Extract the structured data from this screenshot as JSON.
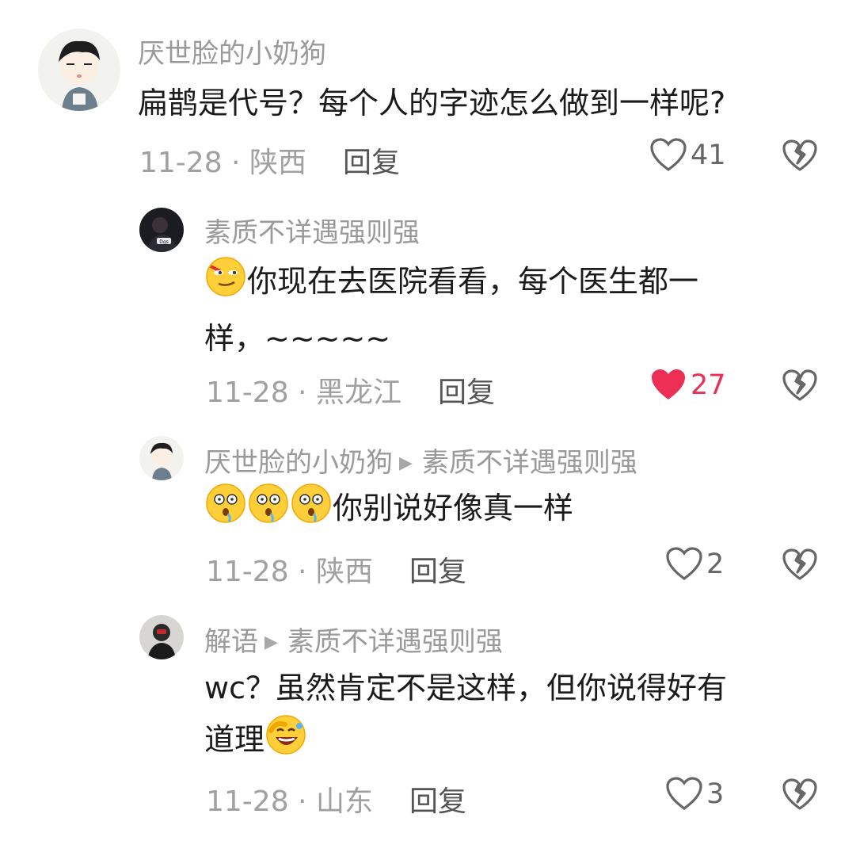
{
  "comments": [
    {
      "username": "厌世脸的小奶狗",
      "text": "扁鹊是代号？每个人的字迹怎么做到一样呢?",
      "date": "11-28 · 陕西",
      "reply_label": "回复",
      "likes": "41",
      "liked": false
    },
    {
      "username": "素质不详遇强则强",
      "text_line1": "你现在去医院看看，每个医生都一",
      "text_line2": "样，~~~~~",
      "date": "11-28 · 黑龙江",
      "reply_label": "回复",
      "likes": "27",
      "liked": true
    },
    {
      "username": "厌世脸的小奶狗",
      "reply_to": "素质不详遇强则强",
      "text": "你别说好像真一样",
      "date": "11-28 · 陕西",
      "reply_label": "回复",
      "likes": "2",
      "liked": false
    },
    {
      "username": "解语",
      "reply_to": "素质不详遇强则强",
      "text_line1": "wc？虽然肯定不是这样，但你说得好有",
      "text_line2": "道理",
      "date": "11-28 · 山东",
      "reply_label": "回复",
      "likes": "3",
      "liked": false
    }
  ],
  "colors": {
    "liked_heart": "#ee2f55",
    "meta_gray": "#a0a0a0"
  }
}
